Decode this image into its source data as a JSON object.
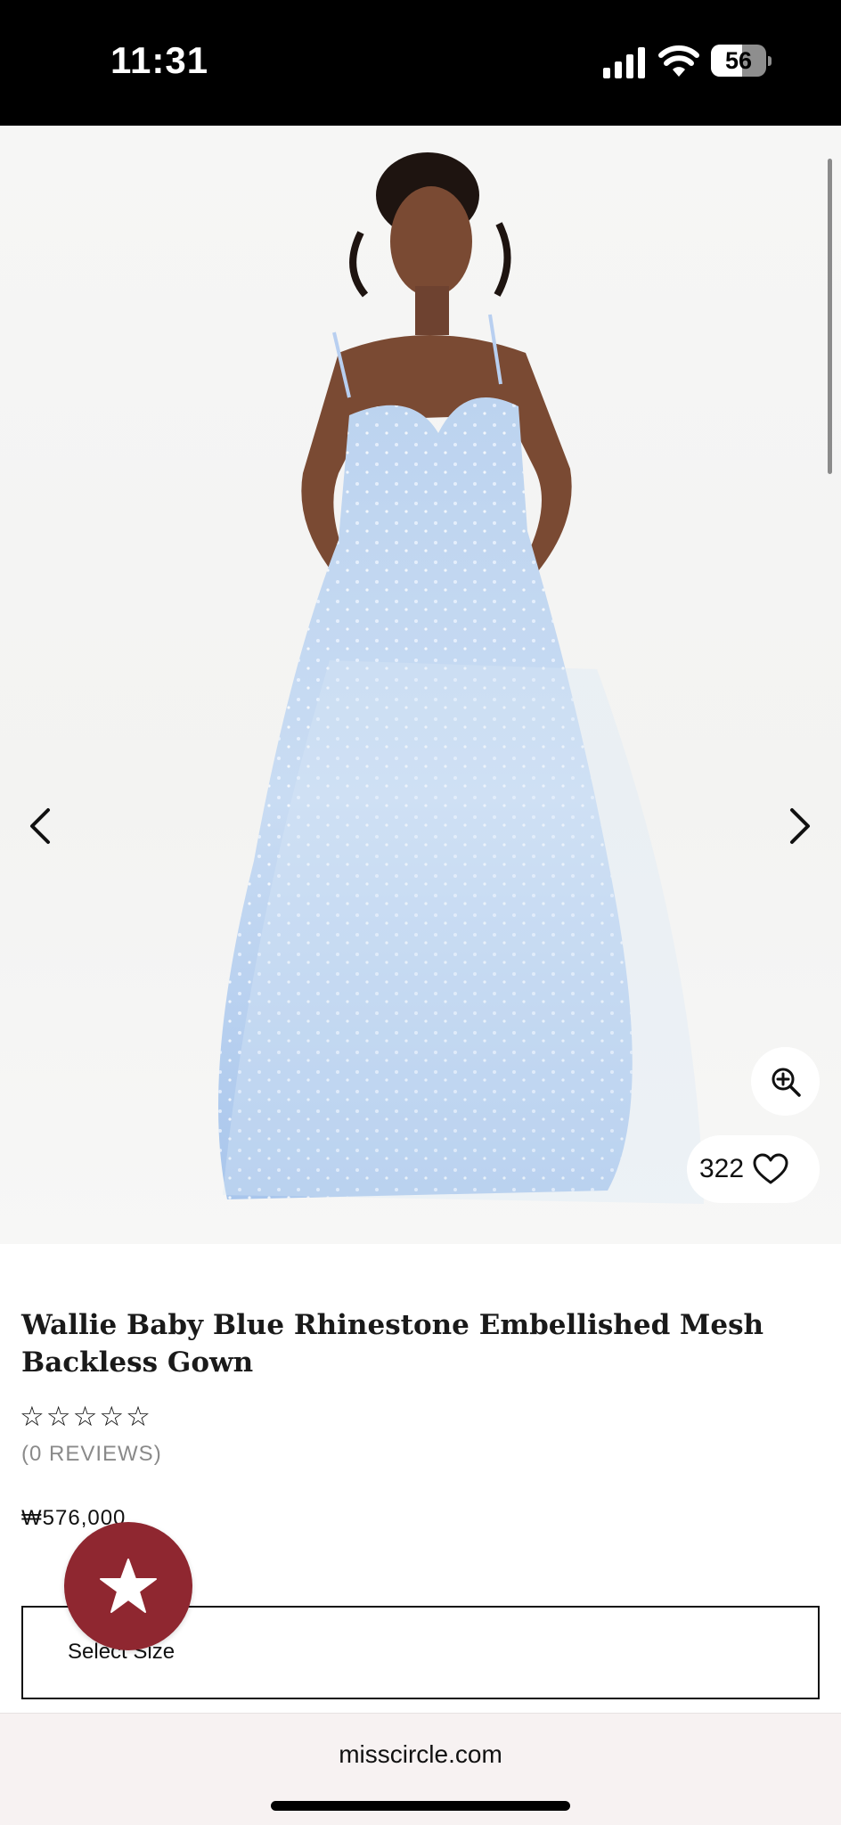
{
  "status_bar": {
    "time": "11:31",
    "battery_level": "56",
    "battery_fraction": 0.56,
    "icons": [
      "signal-icon",
      "wifi-icon",
      "battery-icon"
    ]
  },
  "gallery": {
    "image_description_icon": "model-photo",
    "icons": {
      "prev": "chevron-left-icon",
      "next": "chevron-right-icon",
      "zoom": "zoom-in-icon",
      "like": "heart-icon"
    },
    "like_count": "322"
  },
  "product": {
    "title": "Wallie Baby Blue Rhinestone Embellished Mesh Backless Gown",
    "rating_stars": "☆☆☆☆☆",
    "reviews": "(0 REVIEWS)",
    "price": "₩576,000"
  },
  "size_select": {
    "label": "Select Size"
  },
  "rewards": {
    "icon": "star-icon",
    "color": "#8f2730"
  },
  "browser": {
    "url": "misscircle.com"
  }
}
